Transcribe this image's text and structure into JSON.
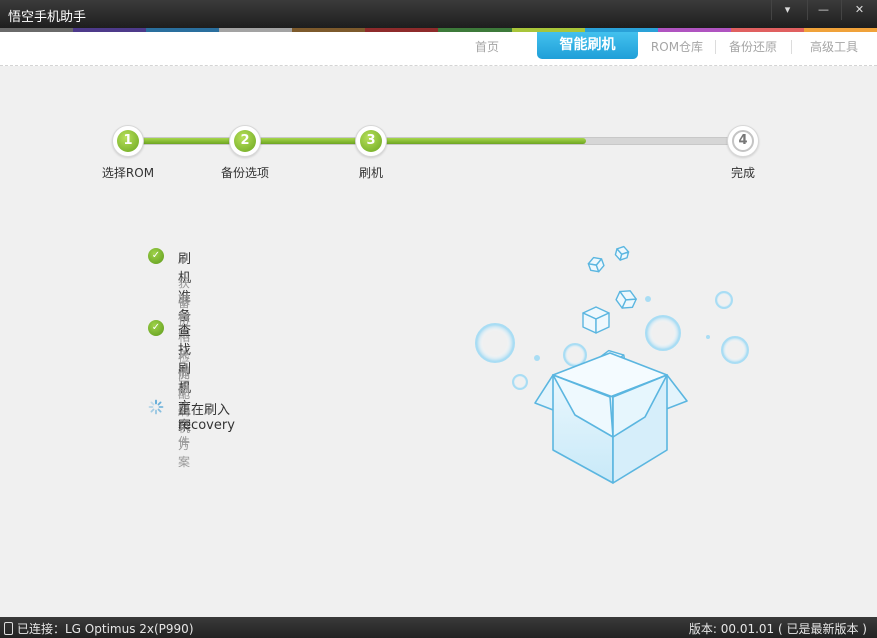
{
  "window": {
    "title": "悟空手机助手",
    "controls": {
      "menu": "▾",
      "minimize": "—",
      "close": "✕"
    }
  },
  "color_stripe": [
    "#6a6a6a",
    "#4d3a8a",
    "#2a6f9e",
    "#a3a3a3",
    "#7d5a2c",
    "#8e2b2b",
    "#3d7a3a",
    "#a8c53a",
    "#2aa1d8",
    "#b054c0",
    "#e06060",
    "#f0a23a"
  ],
  "nav": {
    "items": [
      "首页",
      "智能刷机",
      "ROM仓库",
      "备份还原",
      "高级工具"
    ],
    "active": "智能刷机",
    "active_color": "#2aaee4"
  },
  "stepper": {
    "steps": [
      {
        "number": "1",
        "label": "选择ROM",
        "done": true
      },
      {
        "number": "2",
        "label": "备份选项",
        "done": true
      },
      {
        "number": "3",
        "label": "刷机",
        "done": true
      },
      {
        "number": "4",
        "label": "完成",
        "done": false
      }
    ],
    "progress": 0.74,
    "fill_color": "#7cb82f"
  },
  "tasks": [
    {
      "title": "刷机准备",
      "status": "done",
      "subtasks": [
        "获取权限",
        "备份相关信息"
      ]
    },
    {
      "title": "查找刷机方案",
      "status": "done",
      "subtasks": [
        "检测刷机文件",
        "匹配刷机方案"
      ]
    },
    {
      "title": "正在刷入recovery",
      "status": "in-progress",
      "subtasks": []
    }
  ],
  "illustration": {
    "name": "open-box-with-cubes",
    "color": "#6ec4ea"
  },
  "status": {
    "connection": "已连接：LG Optimus 2x(P990)",
    "version": "版本: 00.01.01 ( 已是最新版本 )"
  }
}
